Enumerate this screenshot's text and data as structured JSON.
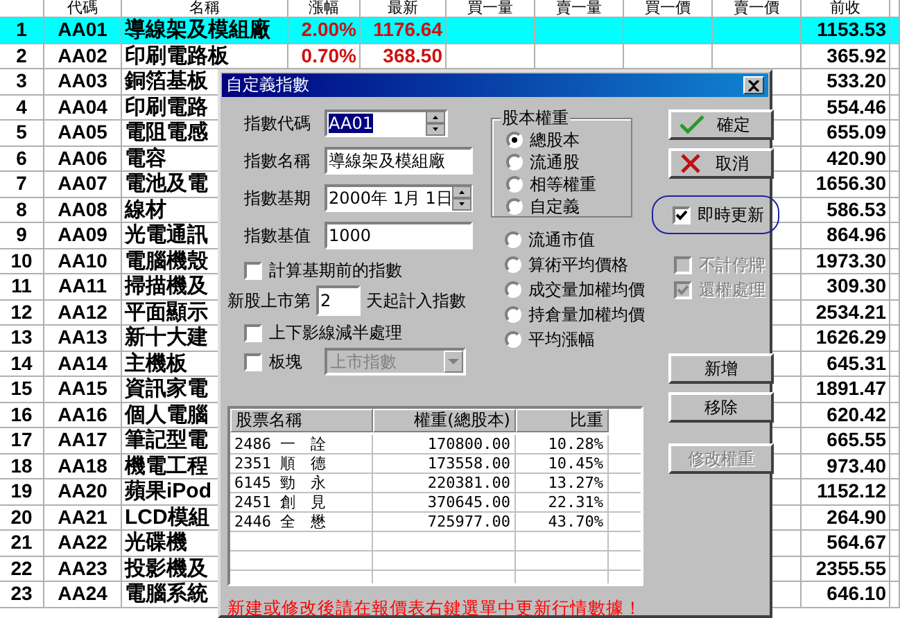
{
  "grid": {
    "columns": [
      "代碼",
      "名稱",
      "漲幅",
      "最新",
      "買一量",
      "賣一量",
      "買一價",
      "賣一價",
      "前收"
    ],
    "rows": [
      {
        "number": "1",
        "code": "AA01",
        "name": "導線架及模組廠",
        "change": "2.00%",
        "last": "1176.64",
        "prev_close": "1153.53",
        "selected": true
      },
      {
        "number": "2",
        "code": "AA02",
        "name": "印刷電路板",
        "change": "0.70%",
        "last": "368.50",
        "prev_close": "365.92",
        "selected": false
      },
      {
        "number": "3",
        "code": "AA03",
        "name": "銅箔基板",
        "prev_close": "533.20",
        "selected": false
      },
      {
        "number": "4",
        "code": "AA04",
        "name": "印刷電路",
        "prev_close": "554.46",
        "selected": false
      },
      {
        "number": "5",
        "code": "AA05",
        "name": "電阻電感",
        "prev_close": "655.09",
        "selected": false
      },
      {
        "number": "6",
        "code": "AA06",
        "name": "電容",
        "prev_close": "420.90",
        "selected": false
      },
      {
        "number": "7",
        "code": "AA07",
        "name": "電池及電",
        "prev_close": "1656.30",
        "selected": false
      },
      {
        "number": "8",
        "code": "AA08",
        "name": "線材",
        "prev_close": "586.53",
        "selected": false
      },
      {
        "number": "9",
        "code": "AA09",
        "name": "光電通訊",
        "prev_close": "864.96",
        "selected": false
      },
      {
        "number": "10",
        "code": "AA10",
        "name": "電腦機殼",
        "prev_close": "1973.30",
        "selected": false
      },
      {
        "number": "11",
        "code": "AA11",
        "name": "掃描機及",
        "prev_close": "309.30",
        "selected": false
      },
      {
        "number": "12",
        "code": "AA12",
        "name": "平面顯示",
        "prev_close": "2534.21",
        "selected": false
      },
      {
        "number": "13",
        "code": "AA13",
        "name": "新十大建",
        "prev_close": "1626.29",
        "selected": false
      },
      {
        "number": "14",
        "code": "AA14",
        "name": "主機板",
        "prev_close": "645.31",
        "selected": false
      },
      {
        "number": "15",
        "code": "AA15",
        "name": "資訊家電",
        "prev_close": "1891.47",
        "selected": false
      },
      {
        "number": "16",
        "code": "AA16",
        "name": "個人電腦",
        "prev_close": "620.42",
        "selected": false
      },
      {
        "number": "17",
        "code": "AA17",
        "name": "筆記型電",
        "prev_close": "665.55",
        "selected": false
      },
      {
        "number": "18",
        "code": "AA18",
        "name": "機電工程",
        "prev_close": "973.40",
        "selected": false
      },
      {
        "number": "19",
        "code": "AA20",
        "name": "蘋果iPod",
        "prev_close": "1152.12",
        "selected": false
      },
      {
        "number": "20",
        "code": "AA21",
        "name": "LCD模組",
        "prev_close": "264.90",
        "selected": false
      },
      {
        "number": "21",
        "code": "AA22",
        "name": "光碟機",
        "prev_close": "564.67",
        "selected": false
      },
      {
        "number": "22",
        "code": "AA23",
        "name": "投影機及",
        "prev_close": "2355.55",
        "selected": false
      },
      {
        "number": "23",
        "code": "AA24",
        "name": "電腦系統",
        "prev_close": "646.10",
        "selected": false
      }
    ]
  },
  "dialog": {
    "title": "自定義指數",
    "fields": [
      {
        "label": "指數代碼",
        "value": "AA01",
        "kind": "spin",
        "text_selected": true
      },
      {
        "label": "指數名稱",
        "value": "導線架及模組廠",
        "kind": "text",
        "text_selected": false
      },
      {
        "label": "指數基期",
        "value": "2000年 1月 1日",
        "kind": "spin",
        "text_selected": false
      },
      {
        "label": "指數基值",
        "value": "1000",
        "kind": "text",
        "text_selected": false
      }
    ],
    "before_base": {
      "label": "計算基期前的指數",
      "checked": false
    },
    "new_listing": {
      "prefix": "新股上市第",
      "value": "2",
      "suffix": "天起計入指數"
    },
    "half_shadow": {
      "label": "上下影線減半處理",
      "checked": false
    },
    "sector": {
      "label": "板塊",
      "checked": false,
      "dropdown": {
        "value": "上市指數",
        "disabled": true
      }
    },
    "weight_group": {
      "title": "股本權重",
      "options": [
        {
          "label": "總股本",
          "selected": true
        },
        {
          "label": "流通股",
          "selected": false
        },
        {
          "label": "相等權重",
          "selected": false
        },
        {
          "label": "自定義",
          "selected": false
        }
      ]
    },
    "methods": [
      {
        "label": "流通市值",
        "selected": false
      },
      {
        "label": "算術平均價格",
        "selected": false
      },
      {
        "label": "成交量加權均價",
        "selected": false
      },
      {
        "label": "持倉量加權均價",
        "selected": false
      },
      {
        "label": "平均漲幅",
        "selected": false
      }
    ],
    "buttons": [
      {
        "label": "確定",
        "kind": "ok"
      },
      {
        "label": "取消",
        "kind": "cancel"
      }
    ],
    "realtime": {
      "label": "即時更新",
      "checked": true
    },
    "options": [
      {
        "label": "不計停牌",
        "checked": false,
        "disabled": true
      },
      {
        "label": "還權處理",
        "checked": true,
        "disabled": true
      }
    ],
    "components": {
      "columns": [
        "股票名稱",
        "權重(總股本)",
        "比重"
      ],
      "rows": [
        {
          "stock": "2486 一　詮",
          "weight": "170800.00",
          "share": "10.28%"
        },
        {
          "stock": "2351 順　德",
          "weight": "173558.00",
          "share": "10.45%"
        },
        {
          "stock": "6145 勁　永",
          "weight": "220381.00",
          "share": "13.27%"
        },
        {
          "stock": "2451 創　見",
          "weight": "370645.00",
          "share": "22.31%"
        },
        {
          "stock": "2446 全　懋",
          "weight": "725977.00",
          "share": "43.70%"
        }
      ]
    },
    "list_buttons": [
      {
        "label": "新增",
        "disabled": false
      },
      {
        "label": "移除",
        "disabled": false
      },
      {
        "label": "修改權重",
        "disabled": true
      }
    ],
    "message": "新建或修改後請在報價表右鍵選單中更新行情數據！"
  }
}
